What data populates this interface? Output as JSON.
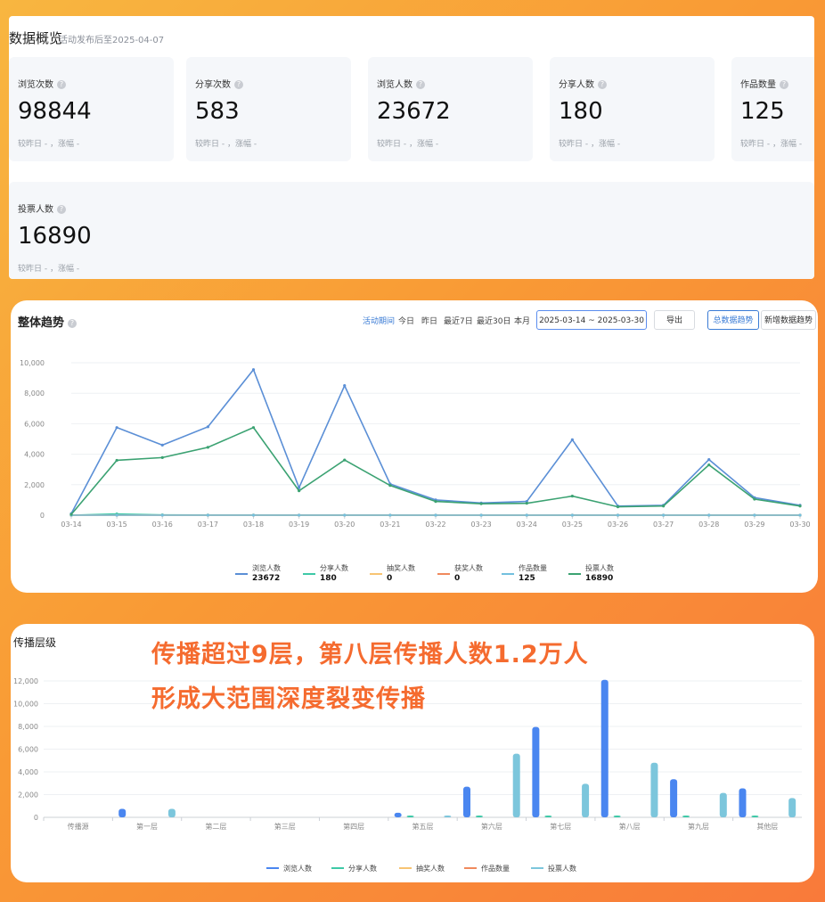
{
  "overview": {
    "title": "数据概览",
    "subtitle": "活动发布后至2025-04-07",
    "cards": [
      {
        "label": "浏览次数",
        "value": "98844",
        "compare": "较昨日 - ，涨幅 -"
      },
      {
        "label": "分享次数",
        "value": "583",
        "compare": "较昨日 - ，涨幅 -"
      },
      {
        "label": "浏览人数",
        "value": "23672",
        "compare": "较昨日 - ，涨幅 -"
      },
      {
        "label": "分享人数",
        "value": "180",
        "compare": "较昨日 - ，涨幅 -"
      },
      {
        "label": "作品数量",
        "value": "125",
        "compare": "较昨日 - ，涨幅 -"
      },
      {
        "label": "投票人数",
        "value": "16890",
        "compare": "较昨日 - ，涨幅 -"
      }
    ]
  },
  "trend": {
    "title": "整体趋势",
    "period_options": [
      "活动期间",
      "今日",
      "昨日",
      "最近7日",
      "最近30日",
      "本月"
    ],
    "active_period": "活动期间",
    "date_range": "2025-03-14 ~ 2025-03-30",
    "export_label": "导出",
    "mode_buttons": [
      "总数据趋势",
      "新增数据趋势"
    ],
    "active_mode": "总数据趋势",
    "legend_totals": [
      "23672",
      "180",
      "0",
      "0",
      "125",
      "16890"
    ]
  },
  "levels": {
    "title": "传播层级",
    "headline_line1": "传播超过9层，第八层传播人数1.2万人",
    "headline_line2": "形成大范围深度裂变传播"
  },
  "colors": {
    "browse": "#5b8fd6",
    "share": "#3ec9a7",
    "lottery": "#f7c473",
    "prize": "#f08a5d",
    "works": "#73c0de",
    "votes": "#3ba272",
    "bar_browse": "#4a86f0",
    "bar_votes": "#7cc6dc",
    "headline": "#f56b2f"
  },
  "chart_data": [
    {
      "type": "line",
      "x": [
        "03-14",
        "03-15",
        "03-16",
        "03-17",
        "03-18",
        "03-19",
        "03-20",
        "03-21",
        "03-22",
        "03-23",
        "03-24",
        "03-25",
        "03-26",
        "03-27",
        "03-28",
        "03-29",
        "03-30"
      ],
      "ylim": [
        0,
        10000
      ],
      "yticks": [
        "0",
        "2,000",
        "4,000",
        "6,000",
        "8,000",
        "10,000"
      ],
      "series": [
        {
          "name": "浏览人数",
          "color": "#5b8fd6",
          "values": [
            100,
            5750,
            4600,
            5800,
            9550,
            1800,
            8500,
            2050,
            1000,
            800,
            900,
            4950,
            600,
            650,
            3650,
            1150,
            650
          ]
        },
        {
          "name": "分享人数",
          "color": "#3ec9a7",
          "values": [
            0,
            80,
            20,
            10,
            10,
            5,
            5,
            5,
            0,
            0,
            0,
            5,
            0,
            0,
            0,
            0,
            0
          ]
        },
        {
          "name": "抽奖人数",
          "color": "#f7c473",
          "values": [
            0,
            0,
            0,
            0,
            0,
            0,
            0,
            0,
            0,
            0,
            0,
            0,
            0,
            0,
            0,
            0,
            0
          ]
        },
        {
          "name": "获奖人数",
          "color": "#f08a5d",
          "values": [
            0,
            0,
            0,
            0,
            0,
            0,
            0,
            0,
            0,
            0,
            0,
            0,
            0,
            0,
            0,
            0,
            0
          ]
        },
        {
          "name": "作品数量",
          "color": "#73c0de",
          "values": [
            0,
            0,
            0,
            0,
            0,
            0,
            0,
            0,
            0,
            0,
            0,
            0,
            0,
            0,
            0,
            0,
            0
          ]
        },
        {
          "name": "投票人数",
          "color": "#3ba272",
          "values": [
            50,
            3600,
            3780,
            4450,
            5750,
            1600,
            3620,
            1950,
            900,
            750,
            780,
            1250,
            550,
            600,
            3300,
            1050,
            600
          ]
        }
      ]
    },
    {
      "type": "bar",
      "categories": [
        "传播源",
        "第一层",
        "第二层",
        "第三层",
        "第四层",
        "第五层",
        "第六层",
        "第七层",
        "第八层",
        "第九层",
        "其他层"
      ],
      "ylim": [
        0,
        12000
      ],
      "yticks": [
        "0",
        "2,000",
        "4,000",
        "6,000",
        "8,000",
        "10,000",
        "12,000"
      ],
      "series": [
        {
          "name": "浏览人数",
          "color": "#4a86f0",
          "values": [
            0,
            750,
            0,
            0,
            0,
            400,
            2700,
            7950,
            12100,
            3350,
            2550
          ]
        },
        {
          "name": "分享人数",
          "color": "#3ec9a7",
          "values": [
            0,
            0,
            0,
            0,
            0,
            20,
            50,
            30,
            20,
            20,
            20
          ]
        },
        {
          "name": "抽奖人数",
          "color": "#f7c473",
          "values": [
            0,
            0,
            0,
            0,
            0,
            0,
            0,
            0,
            0,
            0,
            0
          ]
        },
        {
          "name": "作品数量",
          "color": "#f08a5d",
          "values": [
            0,
            0,
            0,
            0,
            0,
            0,
            0,
            0,
            0,
            0,
            0
          ]
        },
        {
          "name": "投票人数",
          "color": "#7cc6dc",
          "values": [
            0,
            750,
            0,
            0,
            0,
            150,
            5600,
            2950,
            4800,
            2150,
            1700
          ]
        }
      ]
    }
  ]
}
